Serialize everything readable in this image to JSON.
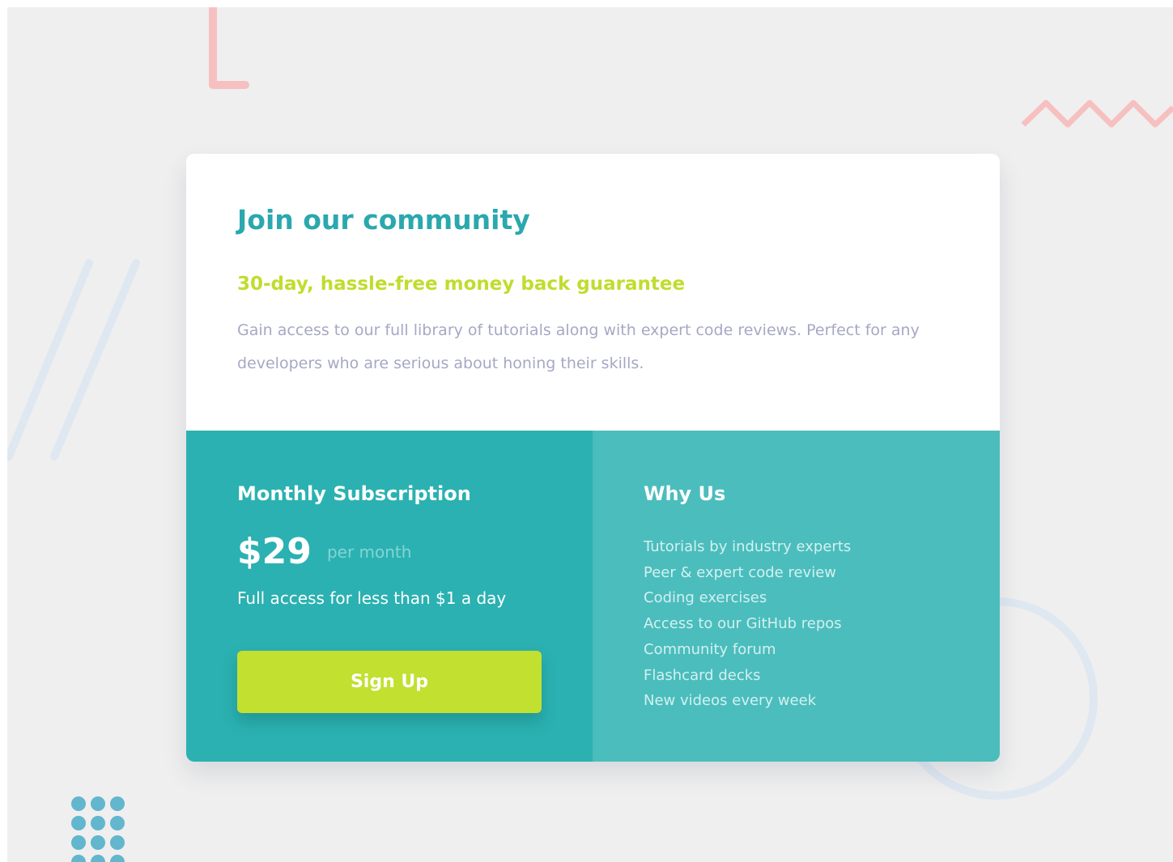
{
  "card": {
    "title": "Join our community",
    "guarantee": "30-day, hassle-free money back guarantee",
    "description": "Gain access to our full library of tutorials along with expert code reviews. Perfect for any developers who are serious about honing their skills."
  },
  "subscription": {
    "title": "Monthly Subscription",
    "price": "$29",
    "period": "per month",
    "note": "Full access for less than $1 a day",
    "signup_label": "Sign Up"
  },
  "why_us": {
    "title": "Why Us",
    "items": [
      "Tutorials by industry experts",
      "Peer & expert code review",
      "Coding exercises",
      "Access to our GitHub repos",
      "Community forum",
      "Flashcard decks",
      "New videos every week"
    ]
  },
  "colors": {
    "page_background": "#efefef",
    "title": "#2aa8ae",
    "guarantee": "#bfdd2d",
    "description": "#a6a8c4",
    "subscription_panel": "#2bb1b1",
    "why_us_panel": "#4bbdbd",
    "signup_button": "#c1e030",
    "decoration_pink": "#f7c0c0",
    "decoration_blue": "#dfe8f1",
    "decoration_dots": "#62b6cd"
  },
  "icons": {
    "decorations": [
      "pink-corner-line",
      "pink-zigzag",
      "blue-diagonal-lines",
      "blue-circle-outline",
      "blue-dot-grid"
    ]
  }
}
